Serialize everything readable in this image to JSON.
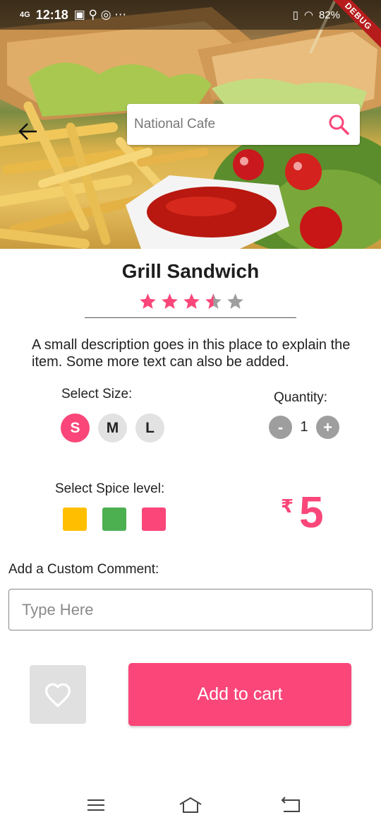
{
  "status_bar": {
    "network": "4G",
    "time": "12:18",
    "battery": "82%",
    "debug_banner": "DEBUG"
  },
  "search": {
    "placeholder": "National Cafe"
  },
  "item": {
    "title": "Grill Sandwich",
    "rating": 3.5,
    "rating_max": 5,
    "description": "A small description goes in this place to explain the item. Some more text can also be added."
  },
  "size": {
    "label": "Select Size:",
    "options": [
      "S",
      "M",
      "L"
    ],
    "selected": "S"
  },
  "quantity": {
    "label": "Quantity:",
    "minus": "-",
    "value": "1",
    "plus": "+"
  },
  "spice": {
    "label": "Select Spice level:",
    "colors": [
      "#ffbf00",
      "#4caf50",
      "#fa4679"
    ]
  },
  "price": {
    "currency": "₹",
    "amount": "5"
  },
  "comment": {
    "label": "Add a Custom Comment:",
    "placeholder": "Type Here"
  },
  "actions": {
    "favorite_icon": "heart-icon",
    "add_to_cart": "Add to cart"
  },
  "colors": {
    "accent": "#fa4679",
    "star_empty": "#9e9e9e"
  }
}
